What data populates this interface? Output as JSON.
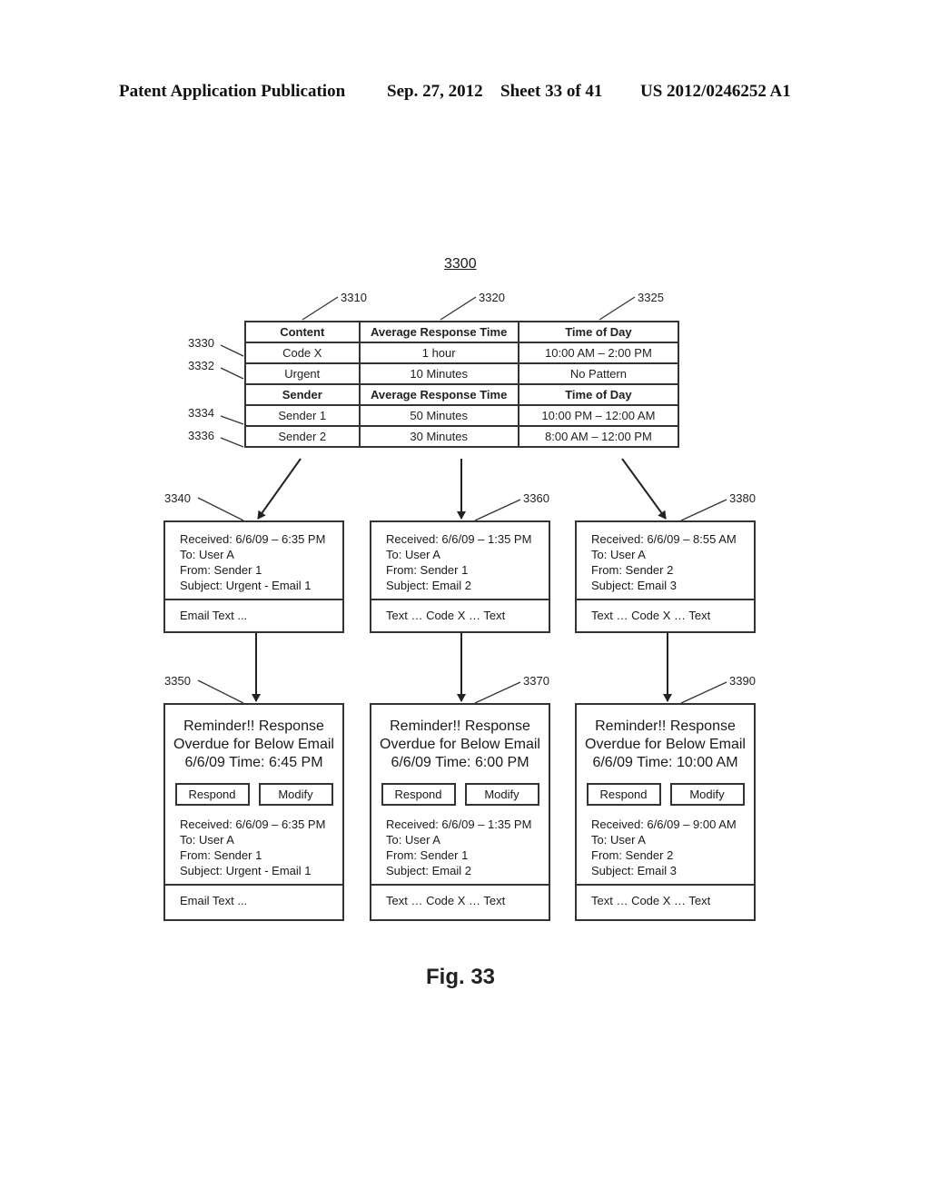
{
  "header": {
    "publication": "Patent Application Publication",
    "date": "Sep. 27, 2012",
    "sheet": "Sheet 33 of 41",
    "number": "US 2012/0246252 A1"
  },
  "figure": {
    "id": "3300",
    "caption": "Fig. 33"
  },
  "refs": {
    "col_content": "3310",
    "col_response": "3320",
    "col_time": "3325",
    "row_code_x": "3330",
    "row_urgent": "3332",
    "row_sender1": "3334",
    "row_sender2": "3336",
    "email1": "3340",
    "reminder1": "3350",
    "email2": "3360",
    "reminder2": "3370",
    "email3": "3380",
    "reminder3": "3390"
  },
  "table": {
    "rows": [
      {
        "header": true,
        "cells": [
          "Content",
          "Average Response Time",
          "Time of Day"
        ]
      },
      {
        "header": false,
        "cells": [
          "Code X",
          "1 hour",
          "10:00 AM – 2:00 PM"
        ]
      },
      {
        "header": false,
        "cells": [
          "Urgent",
          "10 Minutes",
          "No Pattern"
        ]
      },
      {
        "header": true,
        "cells": [
          "Sender",
          "Average Response Time",
          "Time of Day"
        ]
      },
      {
        "header": false,
        "cells": [
          "Sender 1",
          "50 Minutes",
          "10:00 PM – 12:00 AM"
        ]
      },
      {
        "header": false,
        "cells": [
          "Sender 2",
          "30 Minutes",
          "8:00 AM – 12:00 PM"
        ]
      }
    ]
  },
  "emails": [
    {
      "received": "Received: 6/6/09 – 6:35 PM",
      "to": "To: User A",
      "from": "From: Sender 1",
      "subject": "Subject:  Urgent - Email 1",
      "body": "Email Text ..."
    },
    {
      "received": "Received: 6/6/09 – 1:35 PM",
      "to": "To: User A",
      "from": "From: Sender 1",
      "subject": "Subject:  Email 2",
      "body": "Text … Code X … Text"
    },
    {
      "received": "Received: 6/6/09 – 8:55 AM",
      "to": "To: User A",
      "from": "From: Sender 2",
      "subject": "Subject:  Email 3",
      "body": "Text … Code X … Text"
    }
  ],
  "reminders": [
    {
      "line1": "Reminder!! Response",
      "line2": "Overdue for Below Email",
      "line3": "6/6/09 Time:  6:45 PM",
      "respond": "Respond",
      "modify": "Modify",
      "received": "Received: 6/6/09 – 6:35 PM",
      "to": "To: User A",
      "from": "From: Sender 1",
      "subject": "Subject:  Urgent - Email 1",
      "body": "Email Text ..."
    },
    {
      "line1": "Reminder!! Response",
      "line2": "Overdue for Below Email",
      "line3": "6/6/09 Time:  6:00 PM",
      "respond": "Respond",
      "modify": "Modify",
      "received": "Received: 6/6/09 – 1:35 PM",
      "to": "To: User A",
      "from": "From: Sender 1",
      "subject": "Subject:  Email 2",
      "body": "Text … Code X … Text"
    },
    {
      "line1": "Reminder!! Response",
      "line2": "Overdue for Below Email",
      "line3": "6/6/09 Time:  10:00 AM",
      "respond": "Respond",
      "modify": "Modify",
      "received": "Received: 6/6/09 – 9:00 AM",
      "to": "To: User A",
      "from": "From: Sender 2",
      "subject": "Subject:  Email 3",
      "body": "Text … Code X … Text"
    }
  ]
}
